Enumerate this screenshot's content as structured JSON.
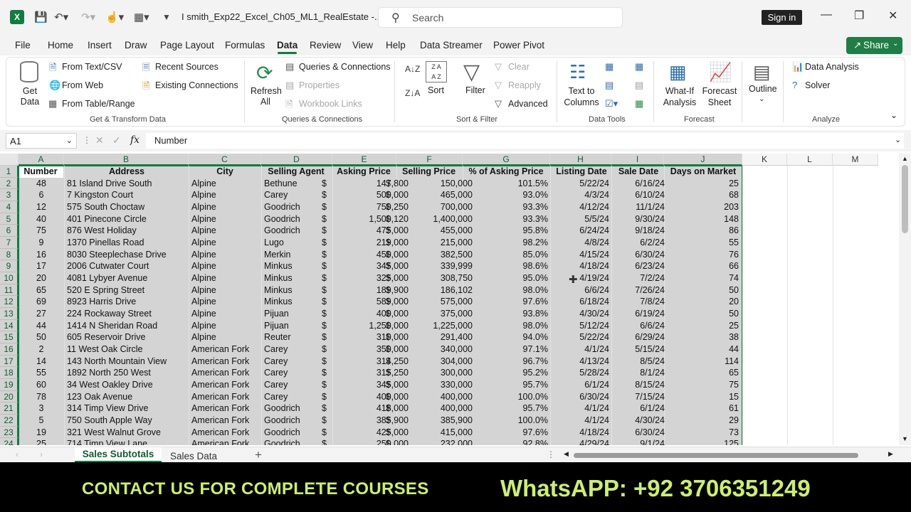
{
  "window": {
    "file_name": "I smith_Exp22_Excel_Ch05_ML1_RealEstate  -...",
    "search_placeholder": "Search",
    "sign_in": "Sign in",
    "share": "Share"
  },
  "tabs": [
    "File",
    "Home",
    "Insert",
    "Draw",
    "Page Layout",
    "Formulas",
    "Data",
    "Review",
    "View",
    "Help",
    "Data Streamer",
    "Power Pivot"
  ],
  "active_tab": "Data",
  "ribbon": {
    "get_data": "Get Data",
    "from_text": "From Text/CSV",
    "from_web": "From Web",
    "from_table": "From Table/Range",
    "recent_sources": "Recent Sources",
    "existing_connections": "Existing Connections",
    "group1": "Get & Transform Data",
    "refresh_all": "Refresh All",
    "queries_connections": "Queries & Connections",
    "properties": "Properties",
    "workbook_links": "Workbook Links",
    "group2": "Queries & Connections",
    "sort": "Sort",
    "filter": "Filter",
    "clear": "Clear",
    "reapply": "Reapply",
    "advanced": "Advanced",
    "group3": "Sort & Filter",
    "text_to_columns": "Text to Columns",
    "group4": "Data Tools",
    "what_if": "What-If Analysis",
    "forecast_sheet": "Forecast Sheet",
    "group5": "Forecast",
    "outline": "Outline",
    "data_analysis": "Data Analysis",
    "solver": "Solver",
    "group6": "Analyze"
  },
  "formula_bar": {
    "name_box": "A1",
    "formula": "Number"
  },
  "columns": [
    "A",
    "B",
    "C",
    "D",
    "E",
    "F",
    "G",
    "H",
    "I",
    "J",
    "K",
    "L",
    "M"
  ],
  "headers": [
    "Number",
    "Address",
    "City",
    "Selling Agent",
    "Asking Price",
    "Selling Price",
    "% of Asking Price",
    "Listing Date",
    "Sale Date",
    "Days on Market"
  ],
  "row_numbers": [
    "1",
    "2",
    "3",
    "4",
    "5",
    "6",
    "7",
    "8",
    "9",
    "10",
    "11",
    "12",
    "13",
    "14",
    "15",
    "16",
    "17",
    "18",
    "19",
    "20",
    "21",
    "22",
    "23",
    "24"
  ],
  "rows": [
    [
      "48",
      "81 Island Drive South",
      "Alpine",
      "Bethune",
      "147,800",
      "150,000",
      "101.5%",
      "5/22/24",
      "6/16/24",
      "25"
    ],
    [
      "6",
      "7 Kingston Court",
      "Alpine",
      "Carey",
      "500,000",
      "465,000",
      "93.0%",
      "4/3/24",
      "6/10/24",
      "68"
    ],
    [
      "12",
      "575 South Choctaw",
      "Alpine",
      "Goodrich",
      "750,250",
      "700,000",
      "93.3%",
      "4/12/24",
      "11/1/24",
      "203"
    ],
    [
      "40",
      "401 Pinecone Circle",
      "Alpine",
      "Goodrich",
      "1,500,120",
      "1,400,000",
      "93.3%",
      "5/5/24",
      "9/30/24",
      "148"
    ],
    [
      "75",
      "876 West Holiday",
      "Alpine",
      "Goodrich",
      "475,000",
      "455,000",
      "95.8%",
      "6/24/24",
      "9/18/24",
      "86"
    ],
    [
      "9",
      "1370 Pinellas Road",
      "Alpine",
      "Lugo",
      "219,000",
      "215,000",
      "98.2%",
      "4/8/24",
      "6/2/24",
      "55"
    ],
    [
      "16",
      "8030 Steeplechase Drive",
      "Alpine",
      "Merkin",
      "450,000",
      "382,500",
      "85.0%",
      "4/15/24",
      "6/30/24",
      "76"
    ],
    [
      "17",
      "2006 Cutwater Court",
      "Alpine",
      "Minkus",
      "345,000",
      "339,999",
      "98.6%",
      "4/18/24",
      "6/23/24",
      "66"
    ],
    [
      "20",
      "4081 Lybyer Avenue",
      "Alpine",
      "Minkus",
      "325,000",
      "308,750",
      "95.0%",
      "4/19/24",
      "7/2/24",
      "74"
    ],
    [
      "65",
      "520 E Spring Street",
      "Alpine",
      "Minkus",
      "189,900",
      "186,102",
      "98.0%",
      "6/6/24",
      "7/26/24",
      "50"
    ],
    [
      "69",
      "8923 Harris Drive",
      "Alpine",
      "Minkus",
      "589,000",
      "575,000",
      "97.6%",
      "6/18/24",
      "7/8/24",
      "20"
    ],
    [
      "27",
      "224 Rockaway Street",
      "Alpine",
      "Pijuan",
      "400,000",
      "375,000",
      "93.8%",
      "4/30/24",
      "6/19/24",
      "50"
    ],
    [
      "44",
      "1414 N Sheridan Road",
      "Alpine",
      "Pijuan",
      "1,250,000",
      "1,225,000",
      "98.0%",
      "5/12/24",
      "6/6/24",
      "25"
    ],
    [
      "50",
      "605 Reservoir Drive",
      "Alpine",
      "Reuter",
      "310,000",
      "291,400",
      "94.0%",
      "5/22/24",
      "6/29/24",
      "38"
    ],
    [
      "2",
      "11 West Oak Circle",
      "American Fork",
      "Carey",
      "350,000",
      "340,000",
      "97.1%",
      "4/1/24",
      "5/15/24",
      "44"
    ],
    [
      "14",
      "143 North Mountain View",
      "American Fork",
      "Carey",
      "314,250",
      "304,000",
      "96.7%",
      "4/13/24",
      "8/5/24",
      "114"
    ],
    [
      "55",
      "1892 North 250 West",
      "American Fork",
      "Carey",
      "315,250",
      "300,000",
      "95.2%",
      "5/28/24",
      "8/1/24",
      "65"
    ],
    [
      "60",
      "34 West Oakley Drive",
      "American Fork",
      "Carey",
      "345,000",
      "330,000",
      "95.7%",
      "6/1/24",
      "8/15/24",
      "75"
    ],
    [
      "78",
      "123 Oak Avenue",
      "American Fork",
      "Carey",
      "400,000",
      "400,000",
      "100.0%",
      "6/30/24",
      "7/15/24",
      "15"
    ],
    [
      "3",
      "314 Timp View Drive",
      "American Fork",
      "Goodrich",
      "418,000",
      "400,000",
      "95.7%",
      "4/1/24",
      "6/1/24",
      "61"
    ],
    [
      "5",
      "750 South Apple Way",
      "American Fork",
      "Goodrich",
      "385,900",
      "385,900",
      "100.0%",
      "4/1/24",
      "4/30/24",
      "29"
    ],
    [
      "19",
      "321 West Walnut Grove",
      "American Fork",
      "Goodrich",
      "425,000",
      "415,000",
      "97.6%",
      "4/18/24",
      "6/30/24",
      "73"
    ],
    [
      "25",
      "714 Timp View Lane",
      "American Fork",
      "Goodrich",
      "250,000",
      "232,000",
      "92.8%",
      "4/29/24",
      "9/1/24",
      "125"
    ]
  ],
  "currency_symbol": "$",
  "sheets": [
    "Sales Subtotals",
    "Sales Data"
  ],
  "active_sheet": "Sales Subtotals",
  "banner": {
    "left": "CONTACT US FOR COMPLETE COURSES",
    "right": "WhatsAPP: +92 3706351249"
  }
}
